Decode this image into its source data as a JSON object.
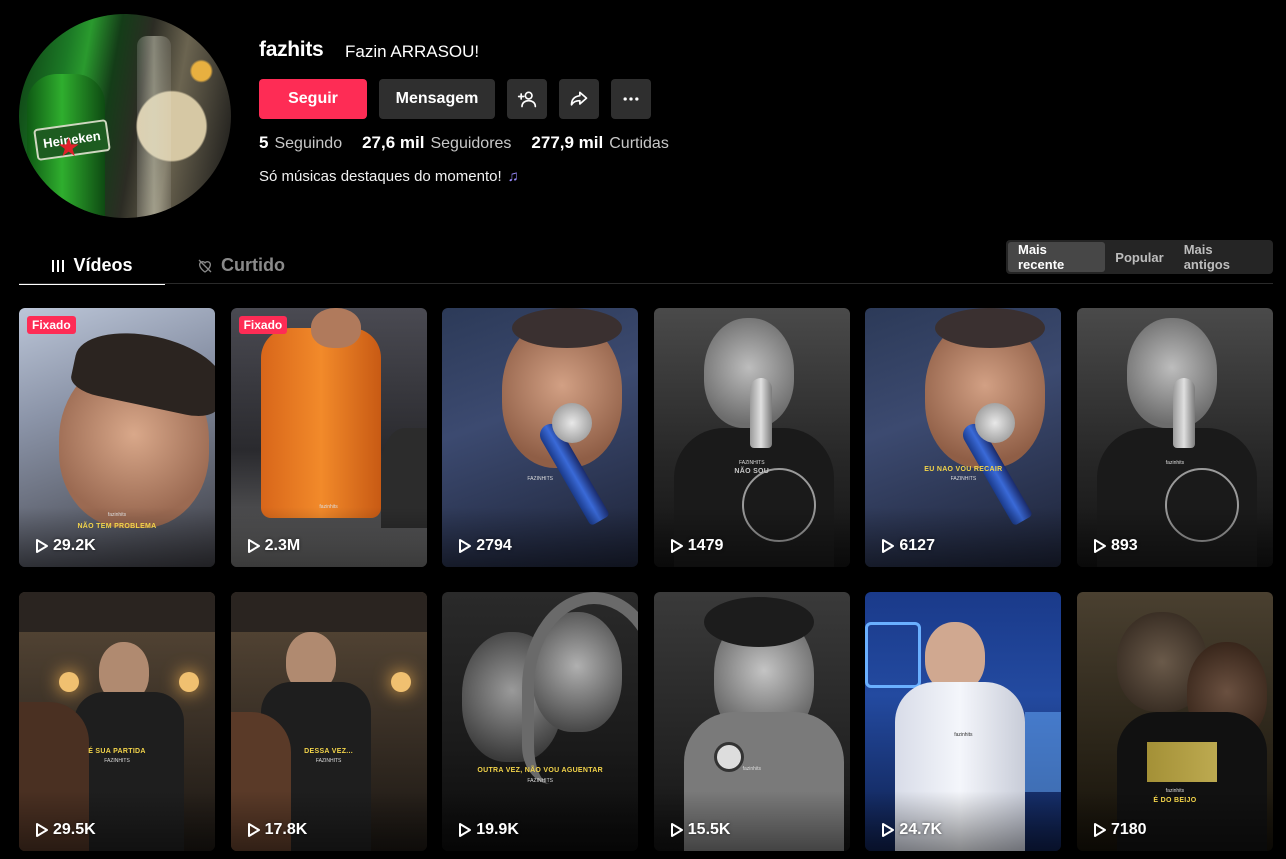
{
  "profile": {
    "username": "fazhits",
    "nickname": "Fazin ARRASOU!",
    "avatar_logo_text": "Heineken",
    "follow_label": "Seguir",
    "message_label": "Mensagem",
    "icons": [
      "add-friend-icon",
      "share-icon",
      "more-icon"
    ],
    "stats": [
      {
        "value": "5",
        "label": "Seguindo"
      },
      {
        "value": "27,6 mil",
        "label": "Seguidores"
      },
      {
        "value": "277,9 mil",
        "label": "Curtidas"
      }
    ],
    "bio": "Só músicas destaques do momento!",
    "bio_emoji": "music-notes-icon"
  },
  "tabs": {
    "videos": "Vídeos",
    "liked": "Curtido"
  },
  "sort": {
    "options": [
      "Mais recente",
      "Popular",
      "Mais antigos"
    ],
    "selected": "Mais recente"
  },
  "videos": [
    {
      "views": "29.2K",
      "pinned": "Fixado",
      "caption": "NÃO TEM PROBLEMA",
      "watermark": "fazinhits"
    },
    {
      "views": "2.3M",
      "pinned": "Fixado",
      "caption": "",
      "watermark": "fazinhits"
    },
    {
      "views": "2794",
      "pinned": "",
      "caption": "",
      "watermark": "FAZINHITS"
    },
    {
      "views": "1479",
      "pinned": "",
      "caption": "NÃO SOU",
      "watermark": "FAZINHITS"
    },
    {
      "views": "6127",
      "pinned": "",
      "caption": "EU NAO VOU RECAIR",
      "watermark": "FAZINHITS"
    },
    {
      "views": "893",
      "pinned": "",
      "caption": "",
      "watermark": "fazinhits"
    },
    {
      "views": "29.5K",
      "pinned": "",
      "caption": "É SUA PARTIDA",
      "watermark": "FAZINHITS"
    },
    {
      "views": "17.8K",
      "pinned": "",
      "caption": "DESSA VEZ...",
      "watermark": "FAZINHITS"
    },
    {
      "views": "19.9K",
      "pinned": "",
      "caption": "OUTRA VEZ, NÃO VOU AGUENTAR",
      "watermark": "FAZINHITS"
    },
    {
      "views": "15.5K",
      "pinned": "",
      "caption": "",
      "watermark": "fazinhits"
    },
    {
      "views": "24.7K",
      "pinned": "",
      "caption": "",
      "watermark": "fazinhits"
    },
    {
      "views": "7180",
      "pinned": "",
      "caption": "É DO BEIJO",
      "watermark": "fazinhits"
    }
  ],
  "colors": {
    "accent": "#fe2c55",
    "background": "#000000",
    "button_dark": "#2f2f2f",
    "caption_yellow": "#f3d44a"
  }
}
